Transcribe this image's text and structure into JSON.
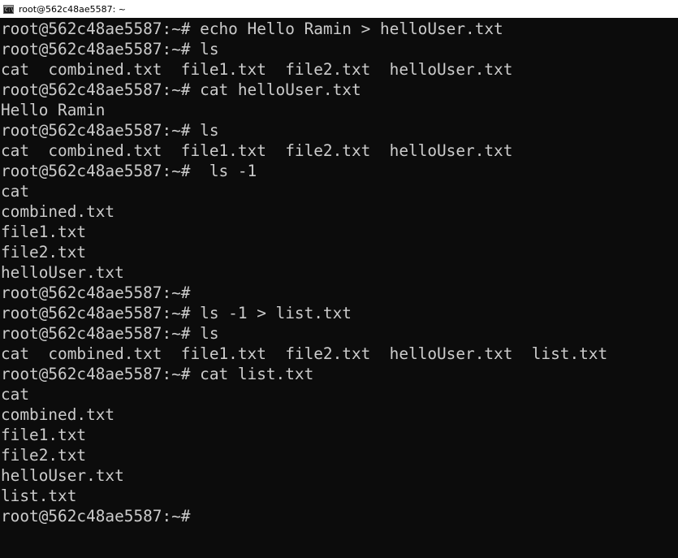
{
  "window": {
    "title": "root@562c48ae5587: ~",
    "icon": "terminal-icon"
  },
  "terminal": {
    "lines": [
      "root@562c48ae5587:~# echo Hello Ramin > helloUser.txt",
      "root@562c48ae5587:~# ls",
      "cat  combined.txt  file1.txt  file2.txt  helloUser.txt",
      "root@562c48ae5587:~# cat helloUser.txt",
      "Hello Ramin",
      "root@562c48ae5587:~# ls",
      "cat  combined.txt  file1.txt  file2.txt  helloUser.txt",
      "root@562c48ae5587:~#  ls -1",
      "cat",
      "combined.txt",
      "file1.txt",
      "file2.txt",
      "helloUser.txt",
      "root@562c48ae5587:~#",
      "root@562c48ae5587:~# ls -1 > list.txt",
      "root@562c48ae5587:~# ls",
      "cat  combined.txt  file1.txt  file2.txt  helloUser.txt  list.txt",
      "root@562c48ae5587:~# cat list.txt",
      "cat",
      "combined.txt",
      "file1.txt",
      "file2.txt",
      "helloUser.txt",
      "list.txt",
      "root@562c48ae5587:~#"
    ]
  },
  "colors": {
    "background": "#0c0c0c",
    "foreground": "#cccccc",
    "titlebar": "#ffffff"
  }
}
